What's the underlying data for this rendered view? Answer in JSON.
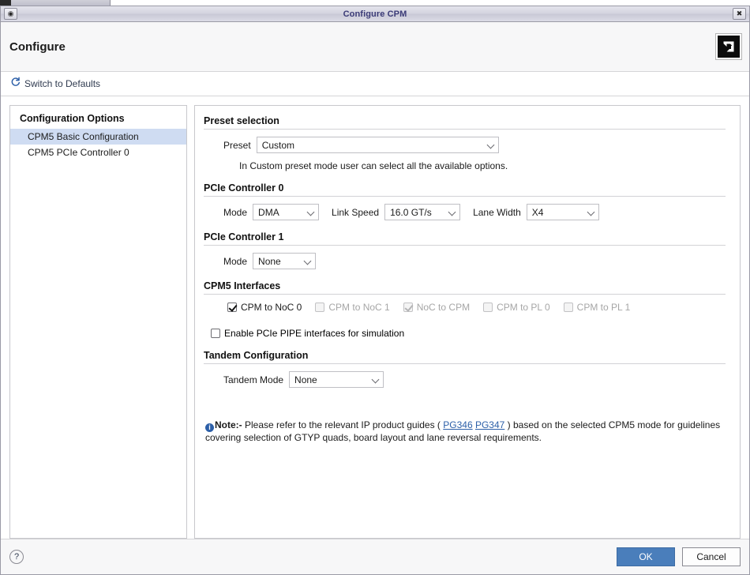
{
  "window": {
    "title": "Configure CPM",
    "sysmenu_icon": "system-menu-icon",
    "close_icon": "close-icon"
  },
  "header": {
    "title": "Configure",
    "logo_icon": "amd-xilinx-logo-icon"
  },
  "toolbar": {
    "switch_defaults_label": "Switch to Defaults",
    "refresh_icon": "refresh-icon"
  },
  "sidebar": {
    "heading": "Configuration Options",
    "items": [
      {
        "label": "CPM5 Basic Configuration",
        "selected": true
      },
      {
        "label": "CPM5 PCIe Controller 0",
        "selected": false
      }
    ]
  },
  "main": {
    "preset_section": {
      "heading": "Preset selection",
      "preset_label": "Preset",
      "preset_value": "Custom",
      "helper_text": "In Custom preset mode user can select all the available options."
    },
    "controller0": {
      "heading": "PCIe Controller 0",
      "mode_label": "Mode",
      "mode_value": "DMA",
      "link_speed_label": "Link Speed",
      "link_speed_value": "16.0 GT/s",
      "lane_width_label": "Lane Width",
      "lane_width_value": "X4"
    },
    "controller1": {
      "heading": "PCIe Controller 1",
      "mode_label": "Mode",
      "mode_value": "None"
    },
    "interfaces": {
      "heading": "CPM5 Interfaces",
      "checkboxes": [
        {
          "label": "CPM to NoC 0",
          "checked": true,
          "disabled": false
        },
        {
          "label": "CPM to NoC 1",
          "checked": false,
          "disabled": true
        },
        {
          "label": "NoC to CPM",
          "checked": true,
          "disabled": true
        },
        {
          "label": "CPM to PL 0",
          "checked": false,
          "disabled": true
        },
        {
          "label": "CPM to PL 1",
          "checked": false,
          "disabled": true
        }
      ],
      "pipe_label": "Enable PCIe PIPE interfaces for simulation",
      "pipe_checked": false
    },
    "tandem": {
      "heading": "Tandem Configuration",
      "mode_label": "Tandem Mode",
      "mode_value": "None"
    },
    "note": {
      "icon": "info-icon",
      "prefix": "Note:-",
      "text_before": " Please refer to the relevant IP product guides ( ",
      "link1": "PG346",
      "link_sep": " ",
      "link2": "PG347",
      "text_after": " ) based on the selected CPM5 mode for guidelines covering selection of GTYP quads, board layout and lane reversal requirements."
    }
  },
  "footer": {
    "help_label": "?",
    "ok_label": "OK",
    "cancel_label": "Cancel"
  },
  "colors": {
    "accent_blue": "#4a7ebb",
    "link_blue": "#2c5fa8",
    "selection": "#cfdcf2"
  }
}
